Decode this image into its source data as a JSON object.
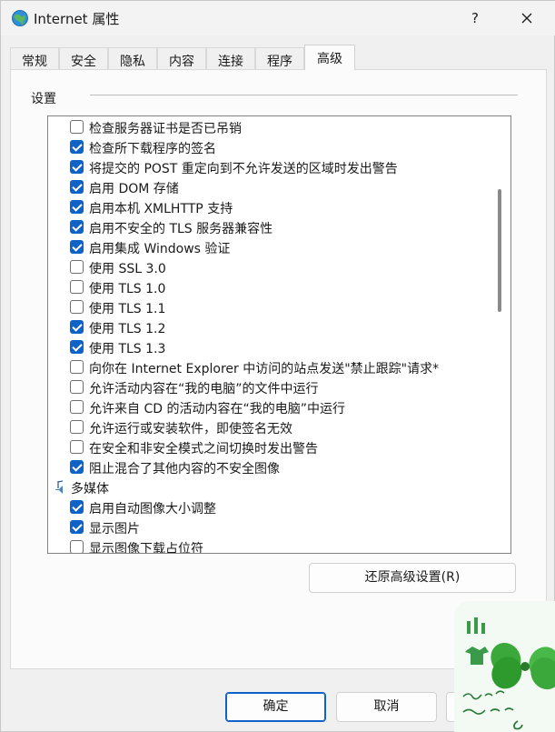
{
  "window": {
    "title": "Internet 属性",
    "help_label": "?"
  },
  "tabs": [
    {
      "label": "常规",
      "active": false
    },
    {
      "label": "安全",
      "active": false
    },
    {
      "label": "隐私",
      "active": false
    },
    {
      "label": "内容",
      "active": false
    },
    {
      "label": "连接",
      "active": false
    },
    {
      "label": "程序",
      "active": false
    },
    {
      "label": "高级",
      "active": true
    }
  ],
  "settings": {
    "group_label": "设置",
    "items": [
      {
        "type": "checkbox",
        "label": "检查服务器证书是否已吊销",
        "checked": false
      },
      {
        "type": "checkbox",
        "label": "检查所下载程序的签名",
        "checked": true
      },
      {
        "type": "checkbox",
        "label": "将提交的 POST 重定向到不允许发送的区域时发出警告",
        "checked": true
      },
      {
        "type": "checkbox",
        "label": "启用 DOM 存储",
        "checked": true
      },
      {
        "type": "checkbox",
        "label": "启用本机 XMLHTTP 支持",
        "checked": true
      },
      {
        "type": "checkbox",
        "label": "启用不安全的 TLS 服务器兼容性",
        "checked": true
      },
      {
        "type": "checkbox",
        "label": "启用集成 Windows 验证",
        "checked": true
      },
      {
        "type": "checkbox",
        "label": "使用 SSL 3.0",
        "checked": false
      },
      {
        "type": "checkbox",
        "label": "使用 TLS 1.0",
        "checked": false
      },
      {
        "type": "checkbox",
        "label": "使用 TLS 1.1",
        "checked": false
      },
      {
        "type": "checkbox",
        "label": "使用 TLS 1.2",
        "checked": true
      },
      {
        "type": "checkbox",
        "label": "使用 TLS 1.3",
        "checked": true
      },
      {
        "type": "checkbox",
        "label": "向你在 Internet Explorer 中访问的站点发送\"禁止跟踪\"请求*",
        "checked": false
      },
      {
        "type": "checkbox",
        "label": "允许活动内容在“我的电脑”的文件中运行",
        "checked": false
      },
      {
        "type": "checkbox",
        "label": "允许来自 CD 的活动内容在“我的电脑”中运行",
        "checked": false
      },
      {
        "type": "checkbox",
        "label": "允许运行或安装软件，即使签名无效",
        "checked": false
      },
      {
        "type": "checkbox",
        "label": "在安全和非安全模式之间切换时发出警告",
        "checked": false
      },
      {
        "type": "checkbox",
        "label": "阻止混合了其他内容的不安全图像",
        "checked": true
      },
      {
        "type": "category",
        "label": "多媒体"
      },
      {
        "type": "checkbox",
        "label": "启用自动图像大小调整",
        "checked": true
      },
      {
        "type": "checkbox",
        "label": "显示图片",
        "checked": true
      },
      {
        "type": "checkbox",
        "label": "显示图像下载占位符",
        "checked": false
      }
    ]
  },
  "restore_button": "还原高级设置(R)",
  "buttons": {
    "ok": "确定",
    "cancel": "取消"
  },
  "colors": {
    "accent": "#0f63c7",
    "window_bg": "#f0f0f0",
    "panel_bg": "#fbfbfb"
  }
}
